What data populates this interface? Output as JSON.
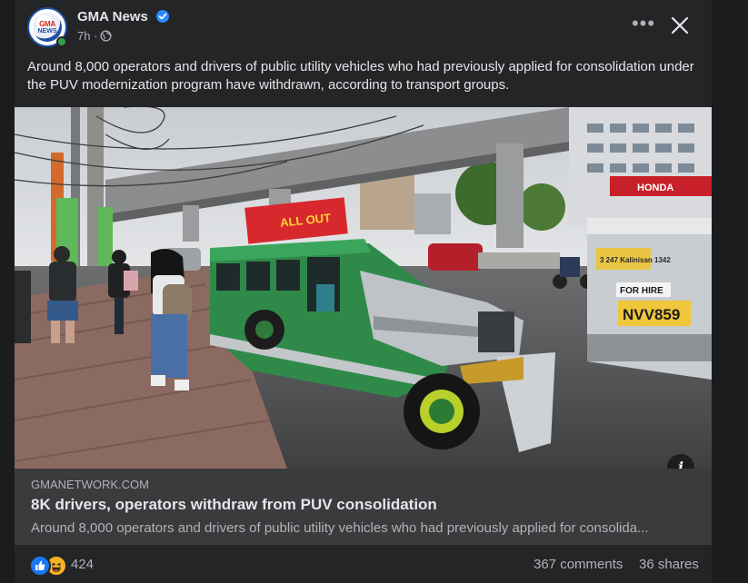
{
  "post": {
    "page_name": "GMA News",
    "avatar_text": "GMA",
    "avatar_subtext": "NEWS",
    "time": "7h ·",
    "icons": {
      "verified": "verified-badge-icon",
      "audience": "globe-icon",
      "more": "more-options-icon",
      "close": "close-icon",
      "info": "info-icon"
    },
    "caption": "Around 8,000 operators and drivers of public utility vehicles who had previously applied for consolidation under the PUV modernization program have withdrawn, according to transport groups.",
    "more_label": "•••"
  },
  "photo": {
    "banner_text": "ALL OUT",
    "sign_text": "HONDA",
    "tag_text": "FOR HIRE",
    "plate_text": "NVV859",
    "route_text": "3 247 Kalinisan 1342"
  },
  "link": {
    "domain": "GMANETWORK.COM",
    "title": "8K drivers, operators withdraw from PUV consolidation",
    "description": "Around 8,000 operators and drivers of public utility vehicles who had previously applied for consolida..."
  },
  "stats": {
    "reaction_count": "424",
    "comments": "367 comments",
    "shares": "36 shares",
    "reaction_icons": [
      "like-icon",
      "haha-icon"
    ]
  },
  "colors": {
    "card_bg": "#242526",
    "page_bg": "#1b1c1e",
    "link_bg": "#3a3b3c",
    "primary_text": "#e4e6eb",
    "secondary_text": "#b0b3b8",
    "like_blue": "#1877f2",
    "verified_blue": "#2d88ff"
  }
}
